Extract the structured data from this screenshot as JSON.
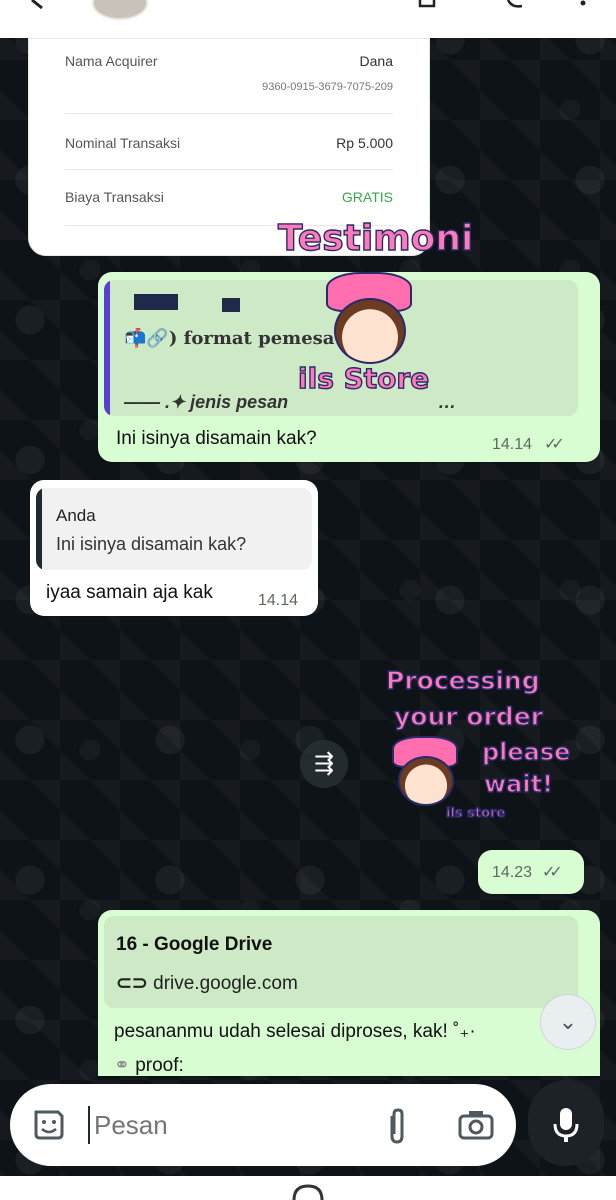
{
  "receipt": {
    "rows": [
      {
        "label": "Nama Acquirer",
        "value": "Dana",
        "sub": "9360-0915-3679-7075-209"
      },
      {
        "label": "Nominal Transaksi",
        "value": "Rp 5.000"
      },
      {
        "label": "Biaya Transaksi",
        "value": "GRATIS"
      }
    ]
  },
  "messages": {
    "m1": {
      "quote_line1": "📬🔗) format pemesa",
      "quote_line2": "—— .✦ jenis pesan",
      "quote_line2_tail": "…",
      "text": "Ini isinya disamain kak?",
      "time": "14.14",
      "ticks": "✓✓"
    },
    "m2": {
      "quote_author": "Anda",
      "quote_text": "Ini isinya disamain kak?",
      "text": "iyaa samain aja kak",
      "time": "14.14"
    },
    "m3": {
      "time": "14.23",
      "ticks": "✓✓"
    },
    "m4": {
      "link_title": "16 - Google Drive",
      "link_domain": "drive.google.com",
      "text": "pesananmu udah selesai diproses, kak! ˚₊·",
      "text2": "proof:"
    }
  },
  "stickers": {
    "testimoni": {
      "title": "Testimoni",
      "subtitle": "ils Store"
    },
    "processing": {
      "line1": "Processing",
      "line2": "your order",
      "line3": "please",
      "line4": "wait!",
      "brand": "ils store"
    }
  },
  "input": {
    "placeholder": "Pesan"
  },
  "icons": {
    "emoji": "sticker-smile-icon",
    "attach": "paperclip-icon",
    "camera": "camera-icon",
    "mic": "microphone-icon",
    "forward": "forward-icon",
    "scroll": "double-chevron-down-icon",
    "link": "link-icon"
  },
  "colors": {
    "outgoing": "#d9fdd3",
    "incoming": "#ffffff",
    "quote_bar_out": "#5b3fd1",
    "quote_bar_in": "#1f2a2f",
    "gratis": "#3aa64c"
  }
}
